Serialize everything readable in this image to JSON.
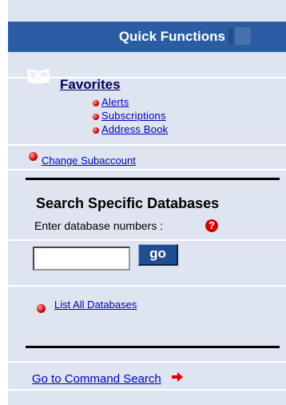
{
  "header": {
    "title": "Quick Functions"
  },
  "favorites": {
    "title": "Favorites",
    "items": [
      "Alerts",
      "Subscriptions",
      "Address Book"
    ]
  },
  "subaccount": {
    "label": "Change Subaccount"
  },
  "search": {
    "title": "Search Specific Databases",
    "prompt": "Enter database numbers :",
    "help_symbol": "?",
    "input_value": "",
    "go_label": "go"
  },
  "list_all": {
    "label": "List All Databases"
  },
  "command_search": {
    "label": "Go to Command Search"
  },
  "colors": {
    "panel": "#dfe4f1",
    "header": "#2a5da3",
    "link": "#0000c0",
    "bullet": "#d00000",
    "go_button": "#1f4f90"
  },
  "icons": {
    "favorites": "open-book-icon",
    "bullet": "red-bullet-icon",
    "help": "question-mark-icon",
    "arrow": "red-arrow-right-icon"
  }
}
